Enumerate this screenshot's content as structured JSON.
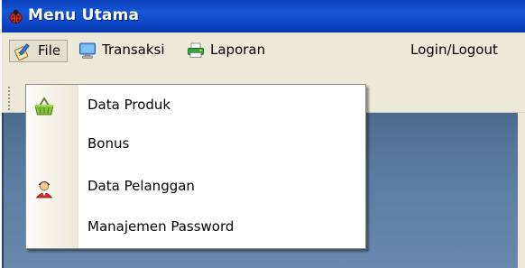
{
  "window": {
    "title": "Menu Utama",
    "icon": "ladybug-icon"
  },
  "menu_bar": {
    "items": [
      {
        "label": "File",
        "icon": "notepad-pencil-icon",
        "active": true
      },
      {
        "label": "Transaksi",
        "icon": "monitor-icon"
      },
      {
        "label": "Laporan",
        "icon": "printer-icon"
      },
      {
        "label": "Login/Logout"
      }
    ]
  },
  "file_menu": {
    "items": [
      {
        "label": "Data Produk",
        "icon": "shopping-basket-icon"
      },
      {
        "label": "Bonus"
      },
      {
        "label": "Data Pelanggan",
        "icon": "customer-person-icon"
      },
      {
        "label": "Manajemen Password"
      }
    ]
  },
  "colors": {
    "title_bar": "#0a3fb8",
    "menu_background": "#ece9d8",
    "client_area": "#5b7ca2"
  }
}
